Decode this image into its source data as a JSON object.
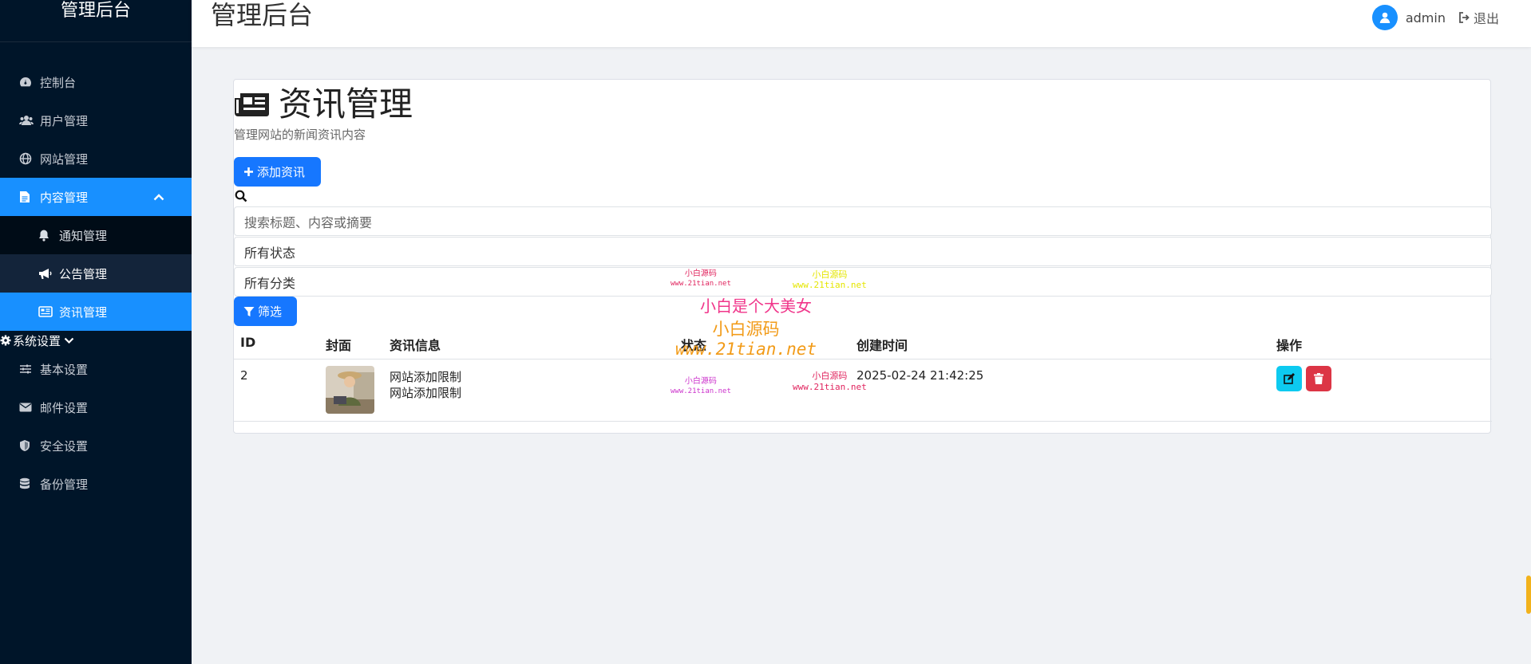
{
  "sidebar": {
    "brand": "管理后台",
    "items": [
      {
        "label": "控制台",
        "icon": "dashboard-icon"
      },
      {
        "label": "用户管理",
        "icon": "users-icon"
      },
      {
        "label": "网站管理",
        "icon": "globe-icon"
      }
    ],
    "content_group": {
      "label": "内容管理",
      "icon": "file-icon",
      "children": [
        {
          "label": "通知管理",
          "icon": "bell-icon"
        },
        {
          "label": "公告管理",
          "icon": "megaphone-icon"
        },
        {
          "label": "资讯管理",
          "icon": "newspaper-icon"
        }
      ]
    },
    "settings_group": {
      "label": "系统设置",
      "icon": "gear-icon",
      "children": [
        {
          "label": "基本设置",
          "icon": "sliders-icon"
        },
        {
          "label": "邮件设置",
          "icon": "mail-icon"
        },
        {
          "label": "安全设置",
          "icon": "shield-icon"
        },
        {
          "label": "备份管理",
          "icon": "database-icon"
        }
      ]
    }
  },
  "header": {
    "title": "管理后台",
    "username": "admin",
    "logout": "退出"
  },
  "page": {
    "title": "资讯管理",
    "subtitle": "管理网站的新闻资讯内容",
    "add_button": "添加资讯",
    "search_placeholder": "搜索标题、内容或摘要",
    "status_select": "所有状态",
    "category_select": "所有分类",
    "filter_button": "筛选"
  },
  "table": {
    "columns": [
      "ID",
      "封面",
      "资讯信息",
      "状态",
      "创建时间",
      "操作"
    ],
    "rows": [
      {
        "id": "2",
        "title": "网站添加限制",
        "summary": "网站添加限制",
        "created_at": "2025-02-24 21:42:25"
      }
    ]
  },
  "watermarks": {
    "w1": "小白源码",
    "w1_url": "www.21tian.net",
    "w2": "小白源码",
    "w2_url": "www.21tian.net",
    "w3": "小白是个大美女",
    "w4": "小白源码",
    "w4_url": "www.21tian.net",
    "w5": "小白源码",
    "w5_url": "www.21tian.net",
    "w6": "小白源码",
    "w6_url": "www.21tian.net"
  },
  "colors": {
    "sidebar_bg": "#001529",
    "accent": "#1890ff",
    "primary_button": "#1677ff",
    "edit_button": "#0dcaf0",
    "delete_button": "#dc3545"
  }
}
